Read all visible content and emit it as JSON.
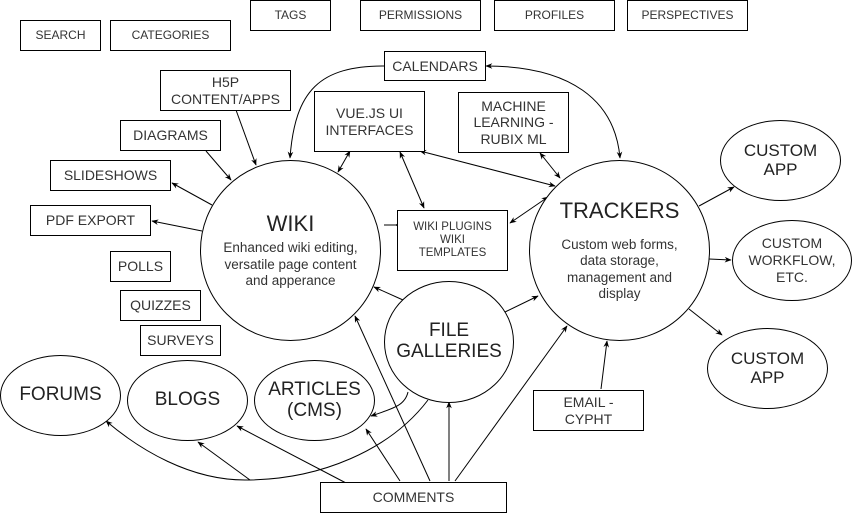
{
  "top_boxes": {
    "search": "SEARCH",
    "categories": "CATEGORIES",
    "tags": "TAGS",
    "permissions": "PERMISSIONS",
    "profiles": "PROFILES",
    "perspectives": "PERSPECTIVES"
  },
  "boxes": {
    "calendars": "CALENDARS",
    "h5p": "H5P CONTENT/APPS",
    "vuejs": "VUE.JS UI INTERFACES",
    "machine_learning": "MACHINE LEARNING - RUBIX ML",
    "diagrams": "DIAGRAMS",
    "slideshows": "SLIDESHOWS",
    "pdf_export": "PDF EXPORT",
    "polls": "POLLS",
    "quizzes": "QUIZZES",
    "surveys": "SURVEYS",
    "wiki_plugins": "WIKI PLUGINS WIKI TEMPLATES",
    "email": "EMAIL - CYPHT",
    "comments": "COMMENTS"
  },
  "nodes": {
    "wiki": {
      "title": "WIKI",
      "subtitle": "Enhanced wiki editing, versatile page content and apperance"
    },
    "trackers": {
      "title": "TRACKERS",
      "subtitle": "Custom web forms, data storage, management and display"
    },
    "file_galleries": {
      "title": "FILE GALLERIES"
    },
    "forums": {
      "title": "FORUMS"
    },
    "blogs": {
      "title": "BLOGS"
    },
    "articles": {
      "title": "ARTICLES (CMS)"
    },
    "custom_app_1": {
      "title": "CUSTOM APP"
    },
    "custom_workflow": {
      "title": "CUSTOM WORKFLOW, ETC."
    },
    "custom_app_2": {
      "title": "CUSTOM APP"
    }
  }
}
